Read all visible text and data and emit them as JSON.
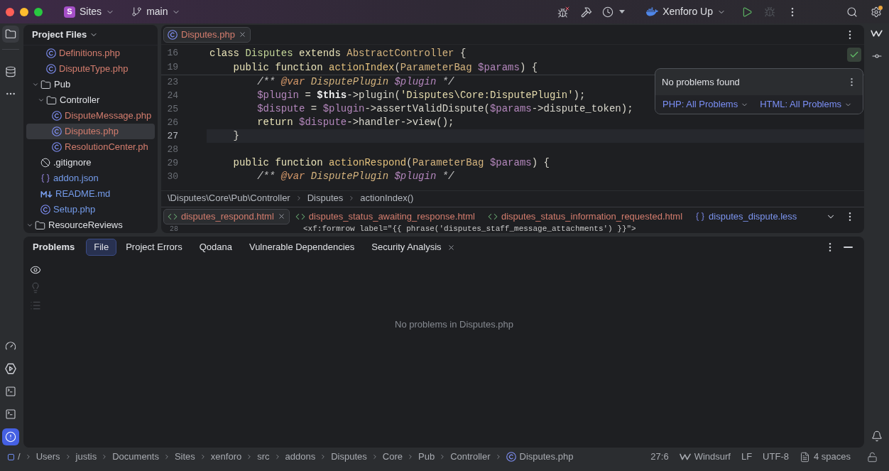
{
  "title_bar": {
    "project": {
      "badge": "S",
      "name": "Sites"
    },
    "branch": "main",
    "run_configuration": "Xenforo Up",
    "actions": [
      {
        "kind": "run",
        "disabled": false
      },
      {
        "kind": "debug",
        "disabled": true
      }
    ]
  },
  "left_rail": {
    "top": [
      {
        "kind": "folder",
        "selected": true
      },
      {
        "kind": "database",
        "selected": false
      },
      {
        "kind": "more",
        "selected": false
      }
    ],
    "bottom": [
      {
        "kind": "gauge",
        "selected": false
      },
      {
        "kind": "services",
        "selected": false
      },
      {
        "kind": "terminal",
        "selected": false
      },
      {
        "kind": "console",
        "selected": false
      },
      {
        "kind": "problems",
        "selected": true
      }
    ]
  },
  "project_panel": {
    "title": "Project Files",
    "tree": [
      {
        "children": [
          {
            "children": [
              {
                "label": "Definitions.php",
                "kind": "php_class",
                "color": "#d47d6e",
                "selected": false
              },
              {
                "label": "DisputeType.php",
                "kind": "php_class",
                "color": "#d47d6e",
                "selected": false
              }
            ]
          },
          {
            "label": "Pub",
            "kind": "folder",
            "color": "#dfe1e5",
            "selected": false,
            "expanded": true,
            "children": [
              {
                "label": "Controller",
                "kind": "folder",
                "color": "#dfe1e5",
                "selected": false,
                "expanded": true,
                "children": [
                  {
                    "label": "DisputeMessage.php",
                    "kind": "php_class",
                    "color": "#d47d6e",
                    "selected": false
                  },
                  {
                    "label": "Disputes.php",
                    "kind": "php_class",
                    "color": "#d47d6e",
                    "selected": true
                  },
                  {
                    "label": "ResolutionCenter.ph",
                    "kind": "php_class",
                    "color": "#d47d6e",
                    "selected": false
                  }
                ]
              }
            ]
          },
          {
            "label": ".gitignore",
            "kind": "ignore",
            "color": "#dfe1e5",
            "selected": false
          },
          {
            "label": "addon.json",
            "kind": "json",
            "color": "#759ceb",
            "selected": false
          },
          {
            "label": "README.md",
            "kind": "markdown",
            "color": "#759ceb",
            "selected": false
          },
          {
            "label": "Setup.php",
            "kind": "php_class",
            "color": "#759ceb",
            "selected": false
          }
        ]
      },
      {
        "label": "ResourceReviews",
        "kind": "folder",
        "color": "#dfe1e5",
        "selected": false,
        "expanded": true
      }
    ]
  },
  "editor": {
    "tabs": [
      {
        "label": "Disputes.php",
        "kind": "php_class",
        "color": "#d47d6e",
        "selected": true,
        "closable": true
      }
    ],
    "sticky_lines": [
      {
        "number": "16",
        "tokens": [
          {
            "text": "class ",
            "kind": "keyword"
          },
          {
            "text": "Disputes ",
            "kind": "class"
          },
          {
            "text": "extends ",
            "kind": "keyword"
          },
          {
            "text": "AbstractController",
            "kind": "type"
          },
          {
            "text": " {",
            "kind": "plain"
          }
        ]
      },
      {
        "number": "19",
        "tokens": [
          {
            "text": "    public function ",
            "kind": "keyword"
          },
          {
            "text": "actionIndex",
            "kind": "function"
          },
          {
            "text": "(",
            "kind": "plain"
          },
          {
            "text": "ParameterBag ",
            "kind": "type"
          },
          {
            "text": "$params",
            "kind": "variable"
          },
          {
            "text": ") {",
            "kind": "plain"
          }
        ]
      }
    ],
    "lines": [
      {
        "number": "23",
        "current": false,
        "tokens": [
          {
            "text": "        /** ",
            "kind": "comment"
          },
          {
            "text": "@var",
            "kind": "doc_tag"
          },
          {
            "text": " DisputePlugin ",
            "kind": "doc_type"
          },
          {
            "text": "$plugin",
            "kind": "doc_var"
          },
          {
            "text": " */",
            "kind": "comment"
          }
        ]
      },
      {
        "number": "24",
        "current": false,
        "tokens": [
          {
            "text": "        $plugin",
            "kind": "variable"
          },
          {
            "text": " = ",
            "kind": "plain"
          },
          {
            "text": "$this",
            "kind": "this"
          },
          {
            "text": "->plugin(",
            "kind": "plain"
          },
          {
            "text": "'Disputes\\Core:DisputePlugin'",
            "kind": "string"
          },
          {
            "text": ");",
            "kind": "plain"
          }
        ]
      },
      {
        "number": "25",
        "current": false,
        "tokens": [
          {
            "text": "        $dispute",
            "kind": "variable"
          },
          {
            "text": " = ",
            "kind": "plain"
          },
          {
            "text": "$plugin",
            "kind": "variable"
          },
          {
            "text": "->assertValidDispute(",
            "kind": "plain"
          },
          {
            "text": "$params",
            "kind": "variable"
          },
          {
            "text": "->dispute_token);",
            "kind": "plain"
          }
        ]
      },
      {
        "number": "26",
        "current": false,
        "tokens": [
          {
            "text": "        return ",
            "kind": "keyword"
          },
          {
            "text": "$dispute",
            "kind": "variable"
          },
          {
            "text": "->handler->view();",
            "kind": "plain"
          }
        ]
      },
      {
        "number": "27",
        "current": true,
        "tokens": [
          {
            "text": "    }",
            "kind": "plain"
          }
        ]
      },
      {
        "number": "28",
        "current": false
      },
      {
        "number": "29",
        "current": false,
        "tokens": [
          {
            "text": "    public function ",
            "kind": "keyword"
          },
          {
            "text": "actionRespond",
            "kind": "function"
          },
          {
            "text": "(",
            "kind": "plain"
          },
          {
            "text": "ParameterBag ",
            "kind": "type"
          },
          {
            "text": "$params",
            "kind": "variable"
          },
          {
            "text": ") {",
            "kind": "plain"
          }
        ]
      },
      {
        "number": "30",
        "current": false,
        "tokens": [
          {
            "text": "        /** ",
            "kind": "comment"
          },
          {
            "text": "@var",
            "kind": "doc_tag"
          },
          {
            "text": " DisputePlugin ",
            "kind": "doc_type"
          },
          {
            "text": "$plugin",
            "kind": "doc_var"
          },
          {
            "text": " */",
            "kind": "comment"
          }
        ]
      }
    ],
    "breadcrumbs": [
      "\\Disputes\\Core\\Pub\\Controller",
      "Disputes",
      "actionIndex()"
    ],
    "problems_popup": {
      "message": "No problems found",
      "filters": [
        "PHP: All Problems",
        "HTML: All Problems"
      ]
    }
  },
  "split_editor": {
    "tabs": [
      {
        "label": "disputes_respond.html",
        "kind": "html",
        "color": "#d47d6e",
        "selected": true,
        "closable": true
      },
      {
        "label": "disputes_status_awaiting_response.html",
        "kind": "html",
        "color": "#d47d6e",
        "selected": false,
        "closable": false
      },
      {
        "label": "disputes_status_information_requested.html",
        "kind": "html",
        "color": "#d47d6e",
        "selected": false,
        "closable": false
      },
      {
        "label": "disputes_dispute.less",
        "kind": "less",
        "color": "#7c95f0",
        "selected": false,
        "closable": false
      }
    ],
    "lines": [
      {
        "number": "28",
        "current": false,
        "tokens": [
          {
            "text": "                    <xf:formrow label=\"{{ phrase('disputes_staff_message_attachments') }}\">",
            "kind": "markup"
          }
        ]
      }
    ]
  },
  "problems": {
    "title": "Problems",
    "tabs": [
      {
        "label": "File",
        "selected": true,
        "closable": false
      },
      {
        "label": "Project Errors",
        "selected": false,
        "closable": false
      },
      {
        "label": "Qodana",
        "selected": false,
        "closable": false
      },
      {
        "label": "Vulnerable Dependencies",
        "selected": false,
        "closable": false
      },
      {
        "label": "Security Analysis",
        "selected": false,
        "closable": true
      }
    ],
    "tools": [
      {
        "kind": "eye",
        "disabled": false
      },
      {
        "kind": "bulb",
        "disabled": true
      },
      {
        "kind": "list",
        "disabled": true
      }
    ],
    "message": "No problems in Disputes.php"
  },
  "status_bar": {
    "path": [
      {
        "label": "/",
        "kind": "root"
      },
      {
        "label": "Users",
        "kind": "folder"
      },
      {
        "label": "justis",
        "kind": "folder"
      },
      {
        "label": "Documents",
        "kind": "folder"
      },
      {
        "label": "Sites",
        "kind": "folder"
      },
      {
        "label": "xenforo",
        "kind": "folder"
      },
      {
        "label": "src",
        "kind": "folder"
      },
      {
        "label": "addons",
        "kind": "folder"
      },
      {
        "label": "Disputes",
        "kind": "folder"
      },
      {
        "label": "Core",
        "kind": "folder"
      },
      {
        "label": "Pub",
        "kind": "folder"
      },
      {
        "label": "Controller",
        "kind": "folder"
      },
      {
        "label": "Disputes.php",
        "kind": "php_class"
      }
    ],
    "caret_position": "27:6",
    "assistant": "Windsurf",
    "line_separator": "LF",
    "encoding": "UTF-8",
    "indent": "4 spaces"
  }
}
